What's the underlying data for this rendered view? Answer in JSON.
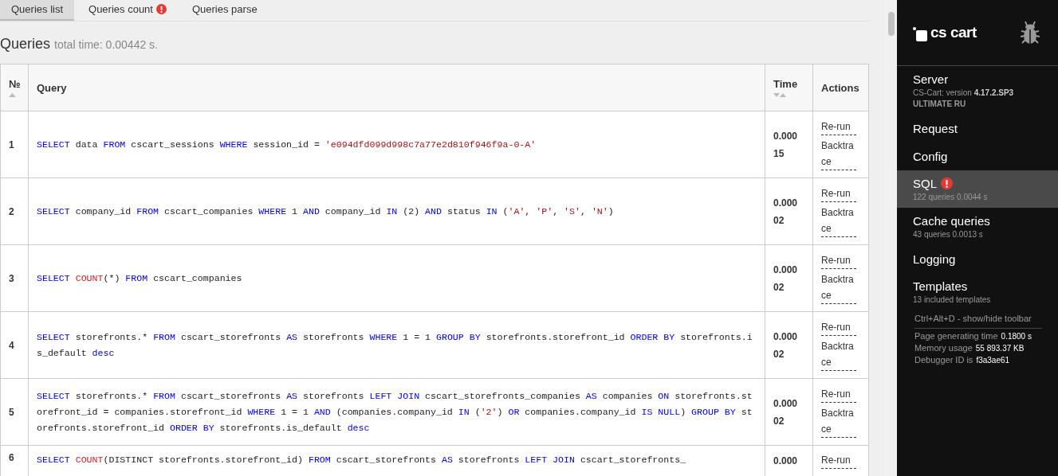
{
  "tabs": [
    {
      "label": "Queries list",
      "selected": true,
      "alert": false
    },
    {
      "label": "Queries count",
      "selected": false,
      "alert": true
    },
    {
      "label": "Queries parse",
      "selected": false,
      "alert": false
    }
  ],
  "heading": {
    "title": "Queries",
    "subtitle": "total time: 0.00442 s."
  },
  "table": {
    "columns": [
      {
        "label": "№",
        "kind": "sorted"
      },
      {
        "label": "Query",
        "kind": "plain"
      },
      {
        "label": "Time",
        "kind": "sortable"
      },
      {
        "label": "Actions",
        "kind": "plain"
      }
    ],
    "rows": [
      {
        "number": "1",
        "time": "0.00015",
        "actions": [
          "Re-run",
          "Backtrace"
        ],
        "query": [
          {
            "kind": "keyword",
            "text": "SELECT"
          },
          {
            "kind": "plain",
            "text": " data "
          },
          {
            "kind": "keyword",
            "text": "FROM"
          },
          {
            "kind": "plain",
            "text": " cscart_sessions "
          },
          {
            "kind": "keyword",
            "text": "WHERE"
          },
          {
            "kind": "plain",
            "text": " session_id = "
          },
          {
            "kind": "string",
            "text": "'e094dfd099d998c7a77e2d810f946f9a-0-A'"
          }
        ]
      },
      {
        "number": "2",
        "time": "0.00002",
        "actions": [
          "Re-run",
          "Backtrace"
        ],
        "query": [
          {
            "kind": "keyword",
            "text": "SELECT"
          },
          {
            "kind": "plain",
            "text": " company_id "
          },
          {
            "kind": "keyword",
            "text": "FROM"
          },
          {
            "kind": "plain",
            "text": " cscart_companies "
          },
          {
            "kind": "keyword",
            "text": "WHERE"
          },
          {
            "kind": "plain",
            "text": " 1 "
          },
          {
            "kind": "keyword",
            "text": "AND"
          },
          {
            "kind": "plain",
            "text": " company_id "
          },
          {
            "kind": "keyword",
            "text": "IN"
          },
          {
            "kind": "plain",
            "text": " (2) "
          },
          {
            "kind": "keyword",
            "text": "AND"
          },
          {
            "kind": "plain",
            "text": " status "
          },
          {
            "kind": "keyword",
            "text": "IN"
          },
          {
            "kind": "plain",
            "text": " ("
          },
          {
            "kind": "string",
            "text": "'A'"
          },
          {
            "kind": "plain",
            "text": ", "
          },
          {
            "kind": "string",
            "text": "'P'"
          },
          {
            "kind": "plain",
            "text": ", "
          },
          {
            "kind": "string",
            "text": "'S'"
          },
          {
            "kind": "plain",
            "text": ", "
          },
          {
            "kind": "string",
            "text": "'N'"
          },
          {
            "kind": "plain",
            "text": ")"
          }
        ]
      },
      {
        "number": "3",
        "time": "0.00002",
        "actions": [
          "Re-run",
          "Backtrace"
        ],
        "query": [
          {
            "kind": "keyword",
            "text": "SELECT "
          },
          {
            "kind": "function",
            "text": "COUNT"
          },
          {
            "kind": "plain",
            "text": "(*) "
          },
          {
            "kind": "keyword",
            "text": "FROM"
          },
          {
            "kind": "plain",
            "text": " cscart_companies"
          }
        ]
      },
      {
        "number": "4",
        "time": "0.00002",
        "actions": [
          "Re-run",
          "Backtrace"
        ],
        "query": [
          {
            "kind": "keyword",
            "text": "SELECT"
          },
          {
            "kind": "plain",
            "text": " storefronts.* "
          },
          {
            "kind": "keyword",
            "text": "FROM"
          },
          {
            "kind": "plain",
            "text": " cscart_storefronts "
          },
          {
            "kind": "keyword",
            "text": "AS"
          },
          {
            "kind": "plain",
            "text": " storefronts "
          },
          {
            "kind": "keyword",
            "text": "WHERE"
          },
          {
            "kind": "plain",
            "text": " 1 = 1 "
          },
          {
            "kind": "keyword",
            "text": "GROUP BY"
          },
          {
            "kind": "plain",
            "text": " storefronts.storefront_id "
          },
          {
            "kind": "keyword",
            "text": "ORDER BY"
          },
          {
            "kind": "plain",
            "text": " storefronts.is_default "
          },
          {
            "kind": "keyword",
            "text": "desc"
          }
        ]
      },
      {
        "number": "5",
        "time": "0.00002",
        "actions": [
          "Re-run",
          "Backtrace"
        ],
        "query": [
          {
            "kind": "keyword",
            "text": "SELECT"
          },
          {
            "kind": "plain",
            "text": " storefronts.* "
          },
          {
            "kind": "keyword",
            "text": "FROM"
          },
          {
            "kind": "plain",
            "text": " cscart_storefronts "
          },
          {
            "kind": "keyword",
            "text": "AS"
          },
          {
            "kind": "plain",
            "text": " storefronts "
          },
          {
            "kind": "keyword",
            "text": "LEFT JOIN"
          },
          {
            "kind": "plain",
            "text": " cscart_storefronts_companies "
          },
          {
            "kind": "keyword",
            "text": "AS"
          },
          {
            "kind": "plain",
            "text": " companies "
          },
          {
            "kind": "keyword",
            "text": "ON"
          },
          {
            "kind": "plain",
            "text": " storefronts.storefront_id = companies.storefront_id "
          },
          {
            "kind": "keyword",
            "text": "WHERE"
          },
          {
            "kind": "plain",
            "text": " 1 = 1 "
          },
          {
            "kind": "keyword",
            "text": "AND"
          },
          {
            "kind": "plain",
            "text": " (companies.company_id "
          },
          {
            "kind": "keyword",
            "text": "IN"
          },
          {
            "kind": "plain",
            "text": " ("
          },
          {
            "kind": "string",
            "text": "'2'"
          },
          {
            "kind": "plain",
            "text": ") "
          },
          {
            "kind": "keyword",
            "text": "OR"
          },
          {
            "kind": "plain",
            "text": " companies.company_id "
          },
          {
            "kind": "keyword",
            "text": "IS NULL"
          },
          {
            "kind": "plain",
            "text": ") "
          },
          {
            "kind": "keyword",
            "text": "GROUP BY"
          },
          {
            "kind": "plain",
            "text": " storefronts.storefront_id "
          },
          {
            "kind": "keyword",
            "text": "ORDER BY"
          },
          {
            "kind": "plain",
            "text": " storefronts.is_default "
          },
          {
            "kind": "keyword",
            "text": "desc"
          }
        ]
      },
      {
        "number": "6",
        "time": "0.000",
        "actions": [
          "Re-run"
        ],
        "query": [
          {
            "kind": "keyword",
            "text": "SELECT "
          },
          {
            "kind": "function",
            "text": "COUNT"
          },
          {
            "kind": "plain",
            "text": "(DISTINCT storefronts.storefront_id) "
          },
          {
            "kind": "keyword",
            "text": "FROM"
          },
          {
            "kind": "plain",
            "text": " cscart_storefronts "
          },
          {
            "kind": "keyword",
            "text": "AS"
          },
          {
            "kind": "plain",
            "text": " storefronts "
          },
          {
            "kind": "keyword",
            "text": "LEFT JOIN"
          },
          {
            "kind": "plain",
            "text": " cscart_storefronts_"
          }
        ]
      }
    ]
  },
  "sidebar": {
    "logo": "cs cart",
    "items": [
      {
        "label": "Server",
        "selected": false,
        "alert": false,
        "details": [
          {
            "text": "CS-Cart: version **4.17.2.SP3**",
            "bold": false
          },
          {
            "text": "ULTIMATE RU",
            "bold": true
          }
        ]
      },
      {
        "label": "Request",
        "selected": false,
        "alert": false
      },
      {
        "label": "Config",
        "selected": false,
        "alert": false
      },
      {
        "label": "SQL",
        "selected": true,
        "alert": true,
        "details": [
          {
            "text": "122 queries 0.0044 s",
            "bold": false
          }
        ]
      },
      {
        "label": "Cache queries",
        "selected": false,
        "alert": false,
        "details": [
          {
            "text": "43 queries 0.0013 s",
            "bold": false
          }
        ]
      },
      {
        "label": "Logging",
        "selected": false,
        "alert": false
      },
      {
        "label": "Templates",
        "selected": false,
        "alert": false,
        "details": [
          {
            "text": "13 included templates",
            "bold": false
          }
        ]
      }
    ],
    "footer": {
      "shortcut": "Ctrl+Alt+D - show/hide toolbar",
      "stats": [
        {
          "label": "Page generating time",
          "value": "0.1800 s"
        },
        {
          "label": "Memory usage",
          "value": "55 893.37 KB"
        },
        {
          "label": "Debugger ID is",
          "value": "f3a3ae61"
        }
      ]
    }
  }
}
